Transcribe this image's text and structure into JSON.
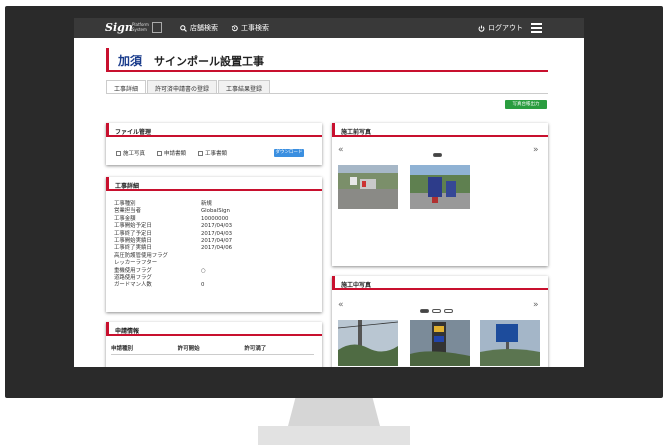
{
  "header": {
    "logo_main": "Sign",
    "logo_sub": "Platform System",
    "nav_store_search": "店舗検索",
    "nav_work_search": "工事検索",
    "logout": "ログアウト"
  },
  "page": {
    "area": "加須",
    "title": "サインポール設置工事",
    "export_photos": "写真台帳出力"
  },
  "tabs": [
    {
      "label": "工事詳細",
      "active": true
    },
    {
      "label": "許可済申請書の登録",
      "active": false
    },
    {
      "label": "工事結果登録",
      "active": false
    }
  ],
  "file_panel": {
    "title": "ファイル管理",
    "options": [
      "施工写真",
      "申請書類",
      "工事書類"
    ],
    "download": "ダウンロード"
  },
  "detail_panel": {
    "title": "工事詳細",
    "rows": [
      {
        "label": "工事種別",
        "value": "新規"
      },
      {
        "label": "営業担当者",
        "value": "GlobalSign"
      },
      {
        "label": "工事金額",
        "value": "10000000"
      },
      {
        "label": "工事開始予定日",
        "value": "2017/04/03"
      },
      {
        "label": "工事終了予定日",
        "value": "2017/04/03"
      },
      {
        "label": "工事開始実績日",
        "value": "2017/04/07"
      },
      {
        "label": "工事終了実績日",
        "value": "2017/04/06"
      },
      {
        "label": "高圧防護管使用フラグ",
        "value": ""
      },
      {
        "label": "レッカーラフター",
        "value": ""
      },
      {
        "label": "重機使用フラグ",
        "value": "○"
      },
      {
        "label": "道路使用フラグ",
        "value": ""
      },
      {
        "label": "ガードマン人数",
        "value": "0"
      }
    ]
  },
  "application_panel": {
    "title": "申請情報",
    "columns": [
      "申請種別",
      "許可開始",
      "許可満了"
    ]
  },
  "before_photos": {
    "title": "施工前写真",
    "prev": "«",
    "next": "»",
    "pages": 1,
    "current_page": 1
  },
  "during_photos": {
    "title": "施工中写真",
    "prev": "«",
    "next": "»",
    "pages": 3,
    "current_page": 1
  },
  "colors": {
    "accent": "#c8102e",
    "title_blue": "#1a3c8c",
    "export_green": "#2a9d3f",
    "download_blue": "#3b8fe0",
    "topbar": "#393939"
  }
}
